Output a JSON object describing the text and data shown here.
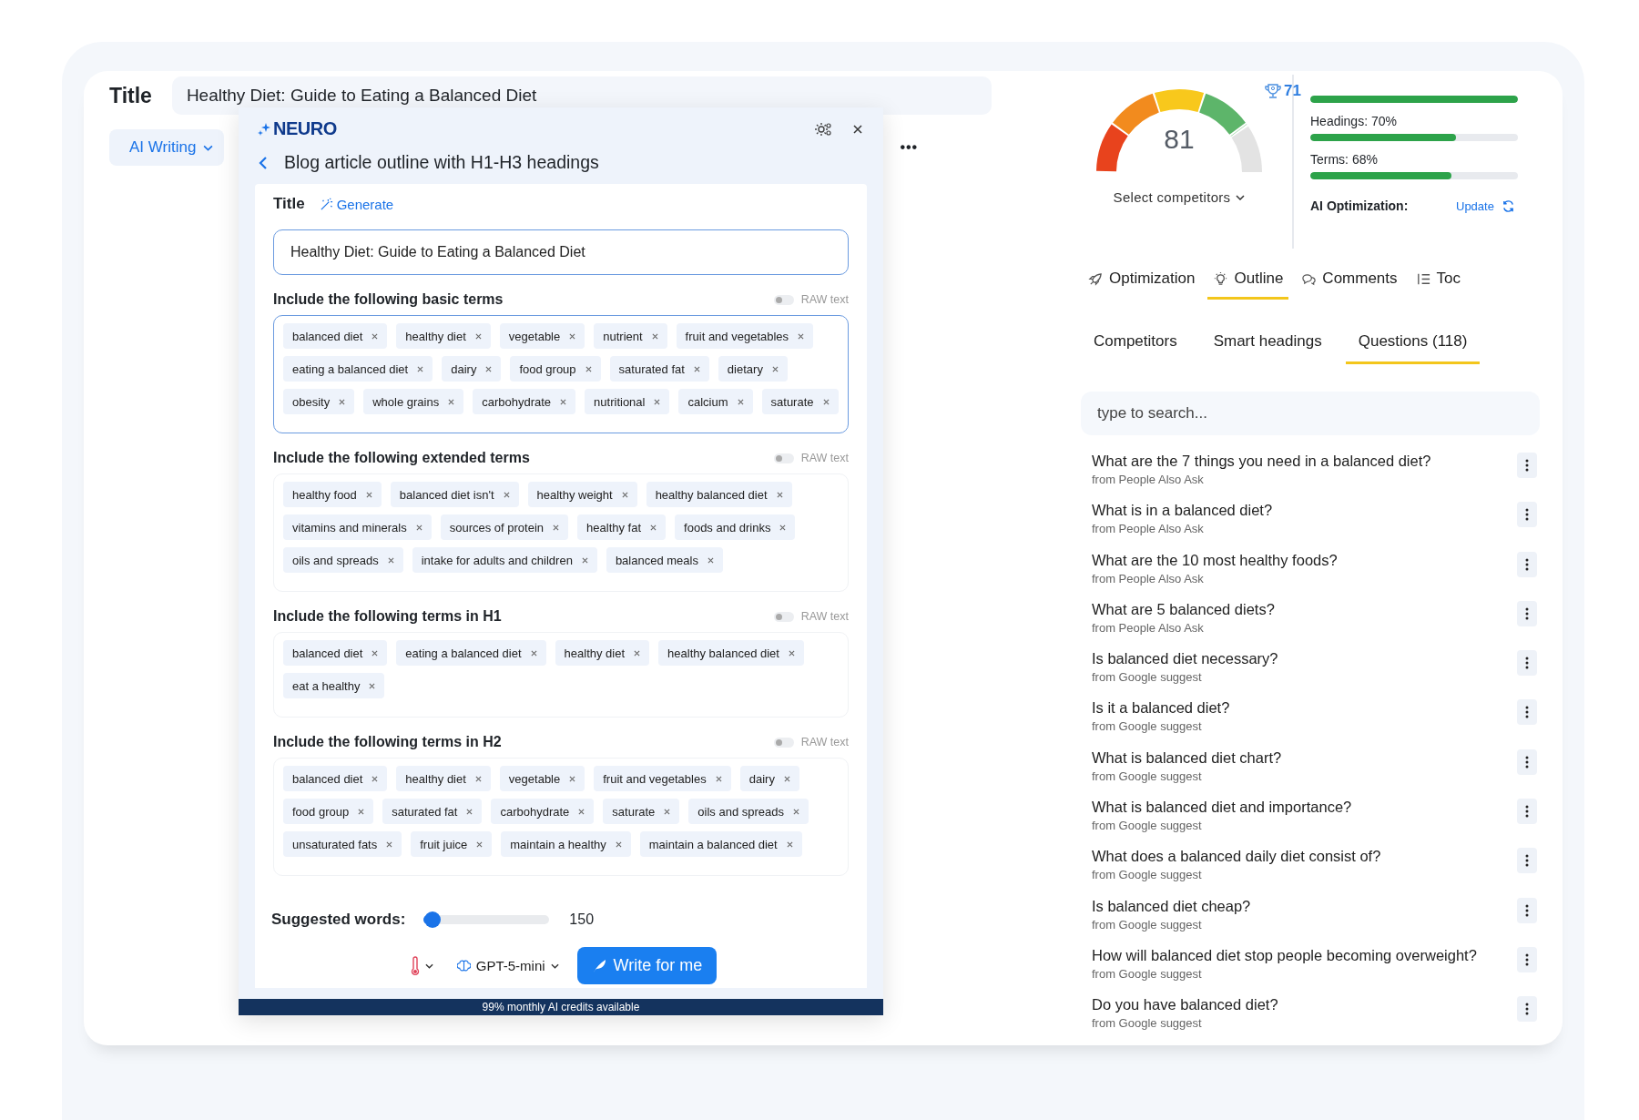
{
  "editor": {
    "title_label": "Title",
    "title_value": "Healthy Diet: Guide to Eating a Balanced Diet",
    "mode_button": "AI Writing",
    "more": "•••"
  },
  "modal": {
    "logo": "NEURO",
    "heading": "Blog article outline with H1-H3 headings",
    "title_label": "Title",
    "generate": "Generate",
    "title_value": "Healthy Diet: Guide to Eating a Balanced Diet",
    "sections": [
      {
        "heading": "Include the following basic terms",
        "raw_label": "RAW text",
        "on": false,
        "focused": true,
        "terms": [
          "balanced diet",
          "healthy diet",
          "vegetable",
          "nutrient",
          "fruit and vegetables",
          "eating a balanced diet",
          "dairy",
          "food group",
          "saturated fat",
          "dietary",
          "obesity",
          "whole grains",
          "carbohydrate",
          "nutritional",
          "calcium",
          "saturate"
        ]
      },
      {
        "heading": "Include the following extended terms",
        "raw_label": "RAW text",
        "on": false,
        "focused": false,
        "terms": [
          "healthy food",
          "balanced diet isn't",
          "healthy weight",
          "healthy balanced diet",
          "vitamins and minerals",
          "sources of protein",
          "healthy fat",
          "foods and drinks",
          "oils and spreads",
          "intake for adults and children",
          "balanced meals"
        ]
      },
      {
        "heading": "Include the following terms in H1",
        "raw_label": "RAW text",
        "on": false,
        "focused": false,
        "terms": [
          "balanced diet",
          "eating a balanced diet",
          "healthy diet",
          "healthy balanced diet",
          "eat a healthy"
        ]
      },
      {
        "heading": "Include the following terms in H2",
        "raw_label": "RAW text",
        "on": false,
        "focused": false,
        "terms": [
          "balanced diet",
          "healthy diet",
          "vegetable",
          "fruit and vegetables",
          "dairy",
          "food group",
          "saturated fat",
          "carbohydrate",
          "saturate",
          "oils and spreads",
          "unsaturated fats",
          "fruit juice",
          "maintain a healthy",
          "maintain a balanced diet"
        ]
      }
    ],
    "words": {
      "label": "Suggested words:",
      "level": 0.07,
      "value": "150"
    },
    "model": "GPT-5-mini",
    "write_button": "Write for me",
    "credits": "99% monthly AI credits available"
  },
  "score": {
    "value": "81",
    "level": 0.81,
    "competitor_score": "71",
    "select": "Select competitors"
  },
  "metrics": [
    {
      "level": 1.0
    },
    {
      "label": "Headings: 70%",
      "level": 0.7
    },
    {
      "label": "Terms: 68%",
      "level": 0.68
    }
  ],
  "ai_optimization": {
    "label": "AI Optimization:",
    "action": "Update"
  },
  "tabs": [
    {
      "label": "Optimization",
      "selected": false
    },
    {
      "label": "Outline",
      "selected": true
    },
    {
      "label": "Comments",
      "selected": false
    },
    {
      "label": "Toc",
      "selected": false
    }
  ],
  "subtabs": [
    {
      "label": "Competitors",
      "selected": false
    },
    {
      "label": "Smart headings",
      "selected": false
    },
    {
      "label": "Questions (118)",
      "selected": true
    }
  ],
  "search": {
    "placeholder": "type to search..."
  },
  "questions": [
    {
      "text": "What are the 7 things you need in a balanced diet?",
      "source": "from People Also Ask"
    },
    {
      "text": "What is in a balanced diet?",
      "source": "from People Also Ask"
    },
    {
      "text": "What are the 10 most healthy foods?",
      "source": "from People Also Ask"
    },
    {
      "text": "What are 5 balanced diets?",
      "source": "from People Also Ask"
    },
    {
      "text": "Is balanced diet necessary?",
      "source": "from Google suggest"
    },
    {
      "text": "Is it a balanced diet?",
      "source": "from Google suggest"
    },
    {
      "text": "What is balanced diet chart?",
      "source": "from Google suggest"
    },
    {
      "text": "What is balanced diet and importance?",
      "source": "from Google suggest"
    },
    {
      "text": "What does a balanced daily diet consist of?",
      "source": "from Google suggest"
    },
    {
      "text": "Is balanced diet cheap?",
      "source": "from Google suggest"
    },
    {
      "text": "How will balanced diet stop people becoming overweight?",
      "source": "from Google suggest"
    },
    {
      "text": "Do you have balanced diet?",
      "source": "from Google suggest"
    }
  ]
}
